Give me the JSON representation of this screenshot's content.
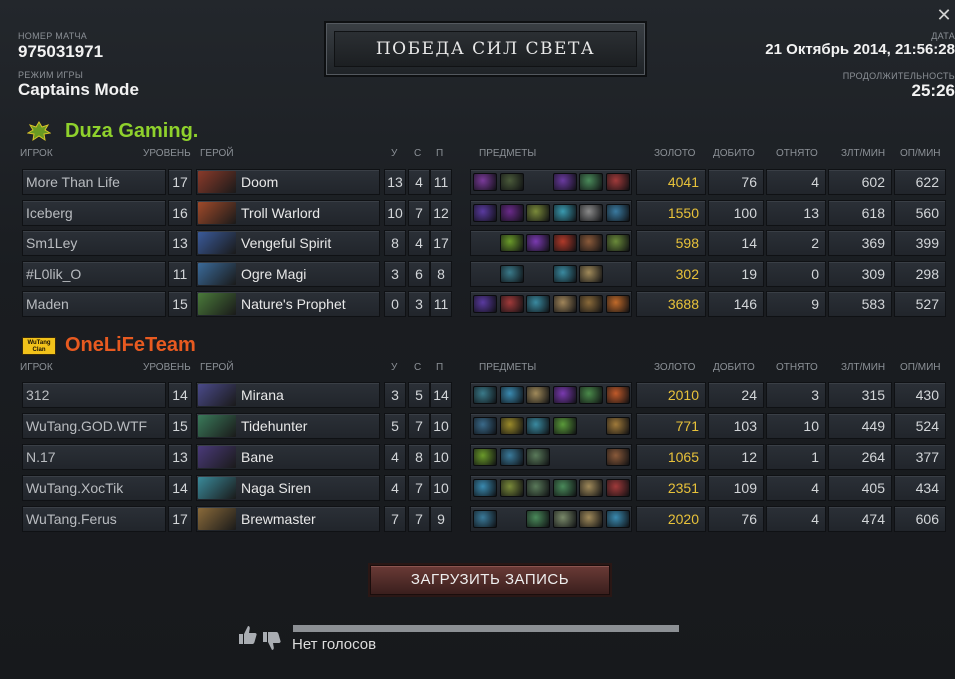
{
  "header": {
    "match_id_label": "НОМЕР МАТЧА",
    "match_id": "975031971",
    "mode_label": "РЕЖИМ ИГРЫ",
    "mode": "Captains Mode",
    "result": "ПОБЕДА СИЛ СВЕТА",
    "date_label": "ДАТА",
    "date": "21 Октябрь 2014, 21:56:28",
    "duration_label": "ПРОДОЛЖИТЕЛЬНОСТЬ",
    "duration": "25:26"
  },
  "columns": {
    "player": "ИГРОК",
    "level": "УРОВЕНЬ",
    "hero": "ГЕРОЙ",
    "kills": "У",
    "deaths": "С",
    "assists": "П",
    "items": "ПРЕДМЕТЫ",
    "gold": "ЗОЛОТО",
    "last_hits": "ДОБИТО",
    "denies": "ОТНЯТО",
    "gpm": "ЗЛТ/МИН",
    "xpm": "ОП/МИН"
  },
  "teams": [
    {
      "name": "Duza Gaming.",
      "color": "#8fd12c",
      "logo_icon": "duza-logo-icon",
      "players": [
        {
          "player": "More Than Life",
          "level": "17",
          "hero": "Doom",
          "hero_color": "#8a3a2a",
          "k": "13",
          "d": "4",
          "a": "11",
          "gold": "4041",
          "lh": "76",
          "dn": "4",
          "gpm": "602",
          "xpm": "622",
          "items": [
            "#7a3a9a",
            "#4a5a3a",
            "",
            "#6a3aa0",
            "#4a8a5a",
            "#a03a3a"
          ]
        },
        {
          "player": "Iceberg",
          "level": "16",
          "hero": "Troll Warlord",
          "hero_color": "#a04a2a",
          "k": "10",
          "d": "7",
          "a": "12",
          "gold": "1550",
          "lh": "100",
          "dn": "13",
          "gpm": "618",
          "xpm": "560",
          "items": [
            "#5a3aa0",
            "#6a2a8a",
            "#7a8a3a",
            "#3a9ab0",
            "#8a8a8a",
            "#3a7aa0"
          ]
        },
        {
          "player": "Sm1Ley",
          "level": "13",
          "hero": "Vengeful Spirit",
          "hero_color": "#3a5a9a",
          "k": "8",
          "d": "4",
          "a": "17",
          "gold": "598",
          "lh": "14",
          "dn": "2",
          "gpm": "369",
          "xpm": "399",
          "items": [
            "",
            "#6a9a2a",
            "#7a3ab0",
            "#b03a2a",
            "#8a5a3a",
            "#6a8a3a"
          ]
        },
        {
          "player": "#L0lik_O",
          "level": "11",
          "hero": "Ogre Magi",
          "hero_color": "#3a6a9a",
          "k": "3",
          "d": "6",
          "a": "8",
          "gold": "302",
          "lh": "19",
          "dn": "0",
          "gpm": "309",
          "xpm": "298",
          "items": [
            "",
            "#3a7a8a",
            "",
            "#3a8aa0",
            "#a08a5a",
            ""
          ]
        },
        {
          "player": "Maden",
          "level": "15",
          "hero": "Nature's Prophet",
          "hero_color": "#4a7a3a",
          "k": "0",
          "d": "3",
          "a": "11",
          "gold": "3688",
          "lh": "146",
          "dn": "9",
          "gpm": "583",
          "xpm": "527",
          "items": [
            "#5a3aa0",
            "#a03a3a",
            "#3a8aa0",
            "#a0855a",
            "#8a6a3a",
            "#c06a2a"
          ]
        }
      ]
    },
    {
      "name": "OneLiFeTeam",
      "color": "#e85a20",
      "logo_icon": "wutang-clan-logo-icon",
      "logo_text": "WuTang Clan",
      "players": [
        {
          "player": "312",
          "level": "14",
          "hero": "Mirana",
          "hero_color": "#4a4a8a",
          "k": "3",
          "d": "5",
          "a": "14",
          "gold": "2010",
          "lh": "24",
          "dn": "3",
          "gpm": "315",
          "xpm": "430",
          "items": [
            "#3a7a8a",
            "#3a8ab0",
            "#a08a5a",
            "#7a3ab0",
            "#4a8a4a",
            "#c05a2a"
          ]
        },
        {
          "player": "WuTang.GOD.WTF",
          "level": "15",
          "hero": "Tidehunter",
          "hero_color": "#3a7a5a",
          "k": "5",
          "d": "7",
          "a": "10",
          "gold": "771",
          "lh": "103",
          "dn": "10",
          "gpm": "449",
          "xpm": "524",
          "items": [
            "#3a6a8a",
            "#9a8a2a",
            "#3a8aa0",
            "#5a9a3a",
            "",
            "#a07a3a"
          ]
        },
        {
          "player": "N.17",
          "level": "13",
          "hero": "Bane",
          "hero_color": "#4a3a7a",
          "k": "4",
          "d": "8",
          "a": "10",
          "gold": "1065",
          "lh": "12",
          "dn": "1",
          "gpm": "264",
          "xpm": "377",
          "items": [
            "#6a9a2a",
            "#3a7a9a",
            "#5a7a5a",
            "",
            "",
            "#8a5a3a"
          ]
        },
        {
          "player": "WuTang.XocTik",
          "level": "14",
          "hero": "Naga Siren",
          "hero_color": "#3a8a9a",
          "k": "4",
          "d": "7",
          "a": "10",
          "gold": "2351",
          "lh": "109",
          "dn": "4",
          "gpm": "405",
          "xpm": "434",
          "items": [
            "#3a8ab0",
            "#7a8a3a",
            "#5a7a5a",
            "#4a8a5a",
            "#a08a5a",
            "#a03a3a"
          ]
        },
        {
          "player": "WuTang.Ferus",
          "level": "17",
          "hero": "Brewmaster",
          "hero_color": "#8a6a3a",
          "k": "7",
          "d": "7",
          "a": "9",
          "gold": "2020",
          "lh": "76",
          "dn": "4",
          "gpm": "474",
          "xpm": "606",
          "items": [
            "#3a7a9a",
            "",
            "#4a8a5a",
            "#7a8a6a",
            "#a08a5a",
            "#3a8ab0"
          ]
        }
      ]
    }
  ],
  "footer": {
    "load_replay": "ЗАГРУЗИТЬ ЗАПИСЬ",
    "votes_text": "Нет голосов",
    "thumbs_up_icon": "thumbs-up-icon",
    "thumbs_down_icon": "thumbs-down-icon"
  }
}
